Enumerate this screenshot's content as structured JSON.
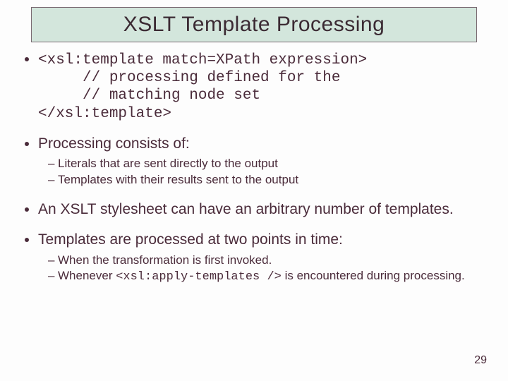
{
  "title": "XSLT Template Processing",
  "bullets": [
    {
      "type": "code",
      "lines": [
        "<xsl:template match=XPath expression>",
        "     // processing defined for the",
        "     // matching node set",
        "</xsl:template>"
      ]
    },
    {
      "type": "text",
      "text": "Processing consists of:",
      "sub": [
        "Literals that are sent directly to the output",
        "Templates with their results sent to the output"
      ]
    },
    {
      "type": "text",
      "text": "An XSLT stylesheet can have an arbitrary number of templates."
    },
    {
      "type": "text",
      "text": "Templates are processed at two points in time:",
      "sub": [
        "When the transformation is first invoked.",
        {
          "prefix": "Whenever ",
          "code": "<xsl:apply-templates />",
          "suffix": " is encountered during processing."
        }
      ]
    }
  ],
  "page_number": "29"
}
